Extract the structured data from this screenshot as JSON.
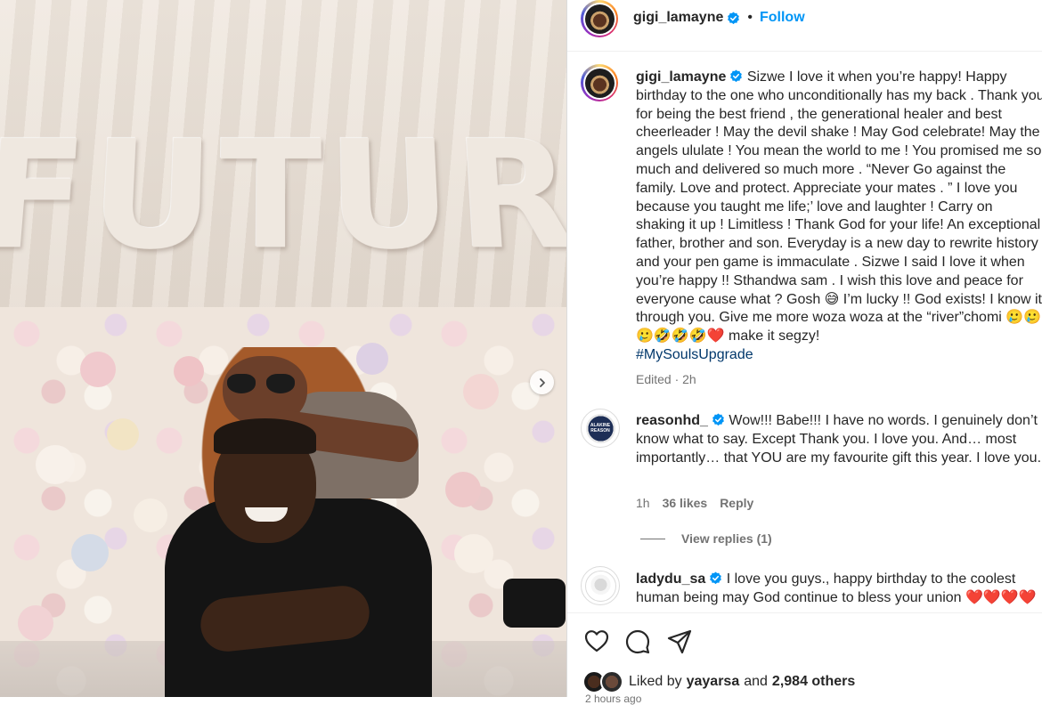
{
  "post": {
    "author": "gigi_lamayne",
    "follow_label": "Follow",
    "separator": "•"
  },
  "caption": {
    "username": "gigi_lamayne",
    "text": "Sizwe I love it when you’re happy! Happy birthday to the one who unconditionally has my back . Thank you for being the best friend , the generational healer and best cheerleader ! May the devil shake ! May God celebrate! May the angels ululate ! You mean the world to me ! You promised me so much and delivered so much more . “Never Go against the family. Love and protect. Appreciate your mates . ” I love you because you taught me life;’ love and laughter ! Carry on shaking it up ! Limitless ! Thank God for your life! An exceptional father, brother and son. Everyday is a new day to rewrite history and your pen game is immaculate . Sizwe I said I love it when you’re happy !! Sthandwa sam . I wish this love and peace for everyone cause what ? Gosh 😅 I’m lucky !! God exists! I know it through you. Give me more woza woza at the “river”chomi 🥲🥲🥲🤣🤣🤣❤️ make it segzy! ",
    "hashtag": "#MySoulsUpgrade",
    "meta": "Edited · 2h"
  },
  "comments": [
    {
      "username": "reasonhd_",
      "text": "Wow!!! Babe!!! I have no words. I genuinely don’t know what to say. Except Thank you. I love you. And… most importantly… that YOU are my favourite gift this year. I love you.",
      "time": "1h",
      "likes": "36 likes",
      "reply": "Reply",
      "view_replies": "View replies (1)",
      "avatar_text": "ALAKINE REASON"
    },
    {
      "username": "ladydu_sa",
      "text": "I love you guys., happy birthday to the coolest human being may God continue to bless your union ❤️❤️❤️❤️"
    }
  ],
  "likes": {
    "prefix": "Liked by",
    "user": "yayarsa",
    "conj": "and",
    "others": "2,984 others"
  },
  "footer_time": "2 hours ago",
  "photo": {
    "backdrop_text": "FUTURE"
  },
  "colors": {
    "accent": "#0095f6",
    "verified": "#0095f6",
    "text": "#262626",
    "muted": "#737373",
    "hashtag": "#00376b"
  },
  "icons": [
    "verified-badge-icon",
    "heart-icon",
    "comment-icon",
    "share-icon",
    "chevron-right-icon"
  ]
}
